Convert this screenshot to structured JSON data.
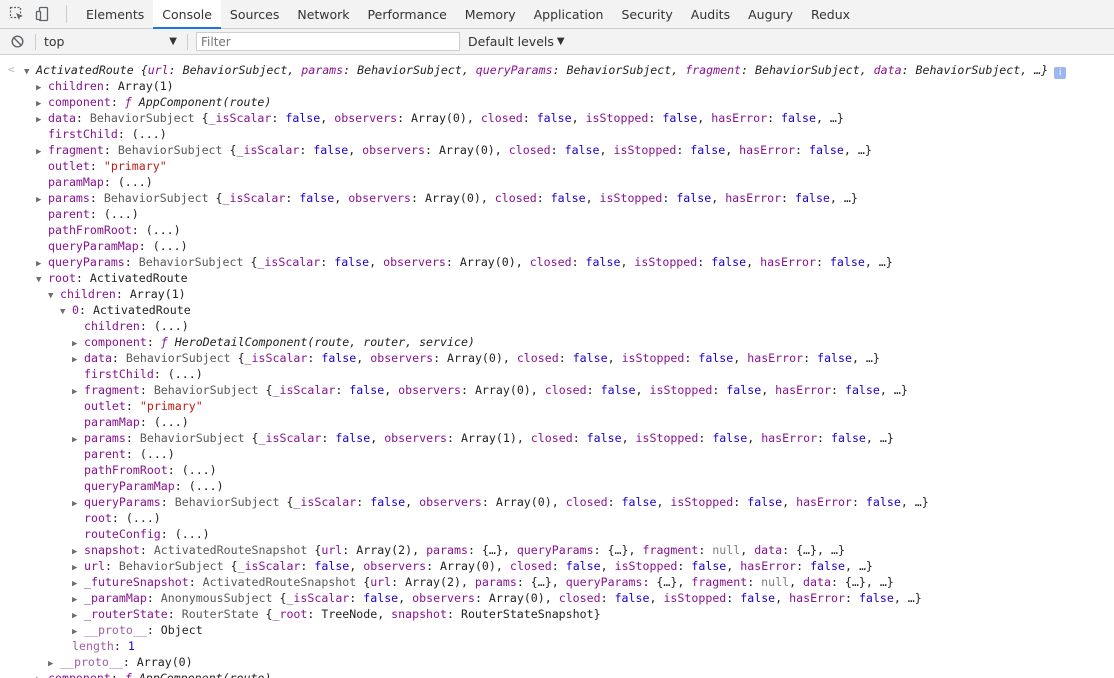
{
  "tabs": [
    "Elements",
    "Console",
    "Sources",
    "Network",
    "Performance",
    "Memory",
    "Application",
    "Security",
    "Audits",
    "Augury",
    "Redux"
  ],
  "active_tab": "Console",
  "toolbar": {
    "context": "top",
    "filter_placeholder": "Filter",
    "levels": "Default levels"
  },
  "colors": {
    "key": "#881391",
    "key_nonenumerable": "#a15ea7",
    "string": "#c41a16",
    "boolean": "#1c00cf",
    "number": "#1c00cf",
    "null": "#808080",
    "class_name": "#595959",
    "accent": "#1a73e8"
  },
  "console_lines": [
    {
      "depth": 0,
      "arrow": "open",
      "prefix": "<",
      "tokens": [
        {
          "t": "ActivatedRoute {",
          "c": "italic"
        },
        {
          "t": "url",
          "c": "italickey"
        },
        {
          "t": ": BehaviorSubject, ",
          "c": "italic"
        },
        {
          "t": "params",
          "c": "italickey"
        },
        {
          "t": ": BehaviorSubject, ",
          "c": "italic"
        },
        {
          "t": "queryParams",
          "c": "italickey"
        },
        {
          "t": ": BehaviorSubject, ",
          "c": "italic"
        },
        {
          "t": "fragment",
          "c": "italickey"
        },
        {
          "t": ": BehaviorSubject, ",
          "c": "italic"
        },
        {
          "t": "data",
          "c": "italickey"
        },
        {
          "t": ": BehaviorSubject, …}",
          "c": "italic"
        }
      ],
      "info": "i"
    },
    {
      "depth": 1,
      "arrow": "closed",
      "key": "children",
      "tokens": [
        {
          "t": "Array(1)",
          "c": "plain"
        }
      ]
    },
    {
      "depth": 1,
      "arrow": "closed",
      "key": "component",
      "tokens": [
        {
          "t": "ƒ ",
          "c": "fn"
        },
        {
          "t": "AppComponent(route)",
          "c": "italic"
        }
      ]
    },
    {
      "depth": 1,
      "arrow": "closed",
      "key": "data",
      "tokens": "BS0"
    },
    {
      "depth": 1,
      "arrow": "none",
      "key": "firstChild",
      "tokens": [
        {
          "t": "(...)",
          "c": "plain"
        }
      ]
    },
    {
      "depth": 1,
      "arrow": "closed",
      "key": "fragment",
      "tokens": "BS0"
    },
    {
      "depth": 1,
      "arrow": "none",
      "key": "outlet",
      "tokens": [
        {
          "t": "\"primary\"",
          "c": "string"
        }
      ]
    },
    {
      "depth": 1,
      "arrow": "none",
      "key": "paramMap",
      "tokens": [
        {
          "t": "(...)",
          "c": "plain"
        }
      ]
    },
    {
      "depth": 1,
      "arrow": "closed",
      "key": "params",
      "tokens": "BS0"
    },
    {
      "depth": 1,
      "arrow": "none",
      "key": "parent",
      "tokens": [
        {
          "t": "(...)",
          "c": "plain"
        }
      ]
    },
    {
      "depth": 1,
      "arrow": "none",
      "key": "pathFromRoot",
      "tokens": [
        {
          "t": "(...)",
          "c": "plain"
        }
      ]
    },
    {
      "depth": 1,
      "arrow": "none",
      "key": "queryParamMap",
      "tokens": [
        {
          "t": "(...)",
          "c": "plain"
        }
      ]
    },
    {
      "depth": 1,
      "arrow": "closed",
      "key": "queryParams",
      "tokens": "BS0"
    },
    {
      "depth": 1,
      "arrow": "open",
      "key": "root",
      "tokens": [
        {
          "t": "ActivatedRoute",
          "c": "plain"
        }
      ]
    },
    {
      "depth": 2,
      "arrow": "open",
      "key": "children",
      "tokens": [
        {
          "t": "Array(1)",
          "c": "plain"
        }
      ]
    },
    {
      "depth": 3,
      "arrow": "open",
      "key": "0",
      "tokens": [
        {
          "t": "ActivatedRoute",
          "c": "plain"
        }
      ]
    },
    {
      "depth": 4,
      "arrow": "none",
      "key": "children",
      "tokens": [
        {
          "t": "(...)",
          "c": "plain"
        }
      ]
    },
    {
      "depth": 4,
      "arrow": "closed",
      "key": "component",
      "tokens": [
        {
          "t": "ƒ ",
          "c": "fn"
        },
        {
          "t": "HeroDetailComponent(route, router, service)",
          "c": "italic"
        }
      ]
    },
    {
      "depth": 4,
      "arrow": "closed",
      "key": "data",
      "tokens": "BS0"
    },
    {
      "depth": 4,
      "arrow": "none",
      "key": "firstChild",
      "tokens": [
        {
          "t": "(...)",
          "c": "plain"
        }
      ]
    },
    {
      "depth": 4,
      "arrow": "closed",
      "key": "fragment",
      "tokens": "BS0"
    },
    {
      "depth": 4,
      "arrow": "none",
      "key": "outlet",
      "tokens": [
        {
          "t": "\"primary\"",
          "c": "string"
        }
      ]
    },
    {
      "depth": 4,
      "arrow": "none",
      "key": "paramMap",
      "tokens": [
        {
          "t": "(...)",
          "c": "plain"
        }
      ]
    },
    {
      "depth": 4,
      "arrow": "closed",
      "key": "params",
      "tokens": "BS1"
    },
    {
      "depth": 4,
      "arrow": "none",
      "key": "parent",
      "tokens": [
        {
          "t": "(...)",
          "c": "plain"
        }
      ]
    },
    {
      "depth": 4,
      "arrow": "none",
      "key": "pathFromRoot",
      "tokens": [
        {
          "t": "(...)",
          "c": "plain"
        }
      ]
    },
    {
      "depth": 4,
      "arrow": "none",
      "key": "queryParamMap",
      "tokens": [
        {
          "t": "(...)",
          "c": "plain"
        }
      ]
    },
    {
      "depth": 4,
      "arrow": "closed",
      "key": "queryParams",
      "tokens": "BS0"
    },
    {
      "depth": 4,
      "arrow": "none",
      "key": "root",
      "tokens": [
        {
          "t": "(...)",
          "c": "plain"
        }
      ]
    },
    {
      "depth": 4,
      "arrow": "none",
      "key": "routeConfig",
      "tokens": [
        {
          "t": "(...)",
          "c": "plain"
        }
      ]
    },
    {
      "depth": 4,
      "arrow": "closed",
      "key": "snapshot",
      "tokens": [
        {
          "t": "ActivatedRouteSnapshot ",
          "c": "cls"
        },
        {
          "t": "{",
          "c": "plain"
        },
        {
          "t": "url",
          "c": "plainkey"
        },
        {
          "t": ": Array(2), ",
          "c": "plain"
        },
        {
          "t": "params",
          "c": "plainkey"
        },
        {
          "t": ": {…}, ",
          "c": "plain"
        },
        {
          "t": "queryParams",
          "c": "plainkey"
        },
        {
          "t": ": {…}, ",
          "c": "plain"
        },
        {
          "t": "fragment",
          "c": "plainkey"
        },
        {
          "t": ": ",
          "c": "plain"
        },
        {
          "t": "null",
          "c": "null"
        },
        {
          "t": ", ",
          "c": "plain"
        },
        {
          "t": "data",
          "c": "plainkey"
        },
        {
          "t": ": {…}, …}",
          "c": "plain"
        }
      ]
    },
    {
      "depth": 4,
      "arrow": "closed",
      "key": "url",
      "tokens": "BS0"
    },
    {
      "depth": 4,
      "arrow": "closed",
      "key": "_futureSnapshot",
      "tokens": [
        {
          "t": "ActivatedRouteSnapshot ",
          "c": "cls"
        },
        {
          "t": "{",
          "c": "plain"
        },
        {
          "t": "url",
          "c": "plainkey"
        },
        {
          "t": ": Array(2), ",
          "c": "plain"
        },
        {
          "t": "params",
          "c": "plainkey"
        },
        {
          "t": ": {…}, ",
          "c": "plain"
        },
        {
          "t": "queryParams",
          "c": "plainkey"
        },
        {
          "t": ": {…}, ",
          "c": "plain"
        },
        {
          "t": "fragment",
          "c": "plainkey"
        },
        {
          "t": ": ",
          "c": "plain"
        },
        {
          "t": "null",
          "c": "null"
        },
        {
          "t": ", ",
          "c": "plain"
        },
        {
          "t": "data",
          "c": "plainkey"
        },
        {
          "t": ": {…}, …}",
          "c": "plain"
        }
      ]
    },
    {
      "depth": 4,
      "arrow": "closed",
      "key": "_paramMap",
      "tokens": [
        {
          "t": "AnonymousSubject ",
          "c": "cls"
        },
        {
          "t": "{",
          "c": "plain"
        },
        {
          "t": "_isScalar",
          "c": "plainkey"
        },
        {
          "t": ": ",
          "c": "plain"
        },
        {
          "t": "false",
          "c": "bool"
        },
        {
          "t": ", ",
          "c": "plain"
        },
        {
          "t": "observers",
          "c": "plainkey"
        },
        {
          "t": ": Array(0), ",
          "c": "plain"
        },
        {
          "t": "closed",
          "c": "plainkey"
        },
        {
          "t": ": ",
          "c": "plain"
        },
        {
          "t": "false",
          "c": "bool"
        },
        {
          "t": ", ",
          "c": "plain"
        },
        {
          "t": "isStopped",
          "c": "plainkey"
        },
        {
          "t": ": ",
          "c": "plain"
        },
        {
          "t": "false",
          "c": "bool"
        },
        {
          "t": ", ",
          "c": "plain"
        },
        {
          "t": "hasError",
          "c": "plainkey"
        },
        {
          "t": ": ",
          "c": "plain"
        },
        {
          "t": "false",
          "c": "bool"
        },
        {
          "t": ", …}",
          "c": "plain"
        }
      ]
    },
    {
      "depth": 4,
      "arrow": "closed",
      "key": "_routerState",
      "tokens": [
        {
          "t": "RouterState ",
          "c": "cls"
        },
        {
          "t": "{",
          "c": "plain"
        },
        {
          "t": "_root",
          "c": "plainkey"
        },
        {
          "t": ": TreeNode, ",
          "c": "plain"
        },
        {
          "t": "snapshot",
          "c": "plainkey"
        },
        {
          "t": ": RouterStateSnapshot}",
          "c": "plain"
        }
      ]
    },
    {
      "depth": 4,
      "arrow": "closed",
      "key": "__proto__",
      "nonenum": true,
      "tokens": [
        {
          "t": "Object",
          "c": "plain"
        }
      ]
    },
    {
      "depth": 3,
      "arrow": "none",
      "key": "length",
      "nonenum": true,
      "tokens": [
        {
          "t": "1",
          "c": "number"
        }
      ]
    },
    {
      "depth": 2,
      "arrow": "closed",
      "key": "__proto__",
      "nonenum": true,
      "tokens": [
        {
          "t": "Array(0)",
          "c": "plain"
        }
      ]
    },
    {
      "depth": 1,
      "arrow": "closed",
      "key": "component",
      "tokens": [
        {
          "t": "ƒ ",
          "c": "fn"
        },
        {
          "t": "AppComponent(route)",
          "c": "italic"
        }
      ]
    }
  ],
  "behavior_subject": {
    "BS0": [
      {
        "t": "BehaviorSubject ",
        "c": "cls"
      },
      {
        "t": "{",
        "c": "plain"
      },
      {
        "t": "_isScalar",
        "c": "plainkey"
      },
      {
        "t": ": ",
        "c": "plain"
      },
      {
        "t": "false",
        "c": "bool"
      },
      {
        "t": ", ",
        "c": "plain"
      },
      {
        "t": "observers",
        "c": "plainkey"
      },
      {
        "t": ": Array(0), ",
        "c": "plain"
      },
      {
        "t": "closed",
        "c": "plainkey"
      },
      {
        "t": ": ",
        "c": "plain"
      },
      {
        "t": "false",
        "c": "bool"
      },
      {
        "t": ", ",
        "c": "plain"
      },
      {
        "t": "isStopped",
        "c": "plainkey"
      },
      {
        "t": ": ",
        "c": "plain"
      },
      {
        "t": "false",
        "c": "bool"
      },
      {
        "t": ", ",
        "c": "plain"
      },
      {
        "t": "hasError",
        "c": "plainkey"
      },
      {
        "t": ": ",
        "c": "plain"
      },
      {
        "t": "false",
        "c": "bool"
      },
      {
        "t": ", …}",
        "c": "plain"
      }
    ],
    "BS1": [
      {
        "t": "BehaviorSubject ",
        "c": "cls"
      },
      {
        "t": "{",
        "c": "plain"
      },
      {
        "t": "_isScalar",
        "c": "plainkey"
      },
      {
        "t": ": ",
        "c": "plain"
      },
      {
        "t": "false",
        "c": "bool"
      },
      {
        "t": ", ",
        "c": "plain"
      },
      {
        "t": "observers",
        "c": "plainkey"
      },
      {
        "t": ": Array(1), ",
        "c": "plain"
      },
      {
        "t": "closed",
        "c": "plainkey"
      },
      {
        "t": ": ",
        "c": "plain"
      },
      {
        "t": "false",
        "c": "bool"
      },
      {
        "t": ", ",
        "c": "plain"
      },
      {
        "t": "isStopped",
        "c": "plainkey"
      },
      {
        "t": ": ",
        "c": "plain"
      },
      {
        "t": "false",
        "c": "bool"
      },
      {
        "t": ", ",
        "c": "plain"
      },
      {
        "t": "hasError",
        "c": "plainkey"
      },
      {
        "t": ": ",
        "c": "plain"
      },
      {
        "t": "false",
        "c": "bool"
      },
      {
        "t": ", …}",
        "c": "plain"
      }
    ]
  }
}
